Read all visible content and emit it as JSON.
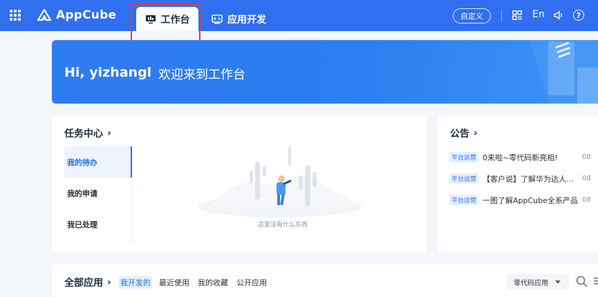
{
  "topbar": {
    "brand": "AppCube",
    "tabs": [
      {
        "label": "工作台",
        "active": true
      },
      {
        "label": "应用开发",
        "active": false
      }
    ],
    "customize_label": "自定义",
    "language_label": "En",
    "help_label": "?"
  },
  "banner": {
    "greeting": "Hi, yizhangl",
    "welcome": "欢迎来到工作台"
  },
  "task_center": {
    "title": "任务中心",
    "menu": [
      "我的待办",
      "我的申请",
      "我已处理"
    ],
    "active_index": 0,
    "empty_text": "这里没有什么东西"
  },
  "notices": {
    "title": "公告",
    "items": [
      {
        "badge": "平台运营",
        "text": "0来啦~零代码新亮相!",
        "date": "08"
      },
      {
        "badge": "平台运营",
        "text": "【客户说】了解华为达人...",
        "date": "08"
      },
      {
        "badge": "平台运营",
        "text": "一图了解AppCube全系产品",
        "date": "08"
      }
    ]
  },
  "all_apps": {
    "title": "全部应用",
    "tabs": [
      "我开发的",
      "最近使用",
      "我的收藏",
      "公开应用"
    ],
    "active_index": 0,
    "type_select": "零代码应用"
  },
  "colors": {
    "primary": "#2f6ff0",
    "highlight_box": "#e53935"
  },
  "icons": [
    "apps-grid-icon",
    "appcube-logo-icon",
    "monitor-icon",
    "code-window-icon",
    "qr-code-icon",
    "sound-icon",
    "help-icon",
    "chevron-right-icon",
    "search-icon",
    "list-icon"
  ]
}
